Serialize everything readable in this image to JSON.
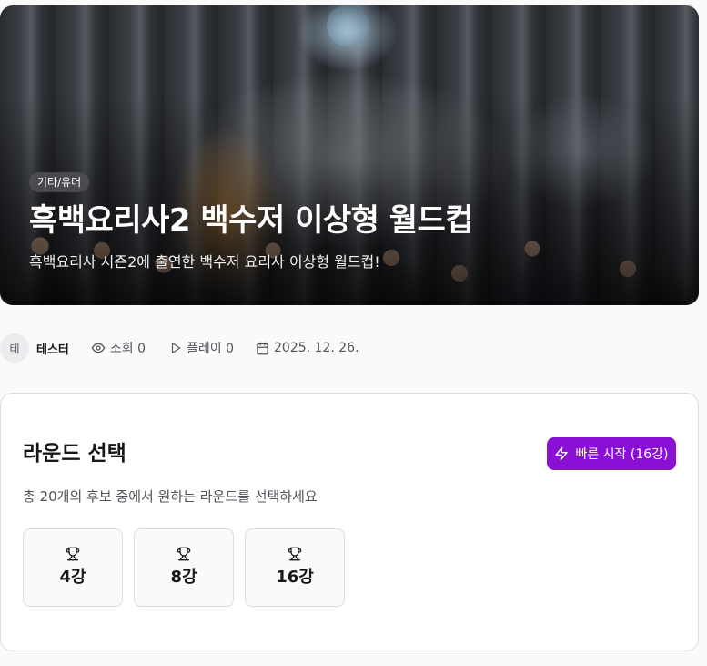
{
  "hero": {
    "badge": "기타/유머",
    "title": "흑백요리사2 백수저 이상형 월드컵",
    "description": "흑백요리사 시즌2에 출연한 백수저 요리사 이상형 월드컵!",
    "image_icon": "cover-image"
  },
  "meta": {
    "avatar_initial": "테",
    "author": "테스터",
    "views_label": "조회 0",
    "views_icon": "eye-icon",
    "plays_label": "플레이 0",
    "plays_icon": "play-icon",
    "date": "2025. 12. 26.",
    "date_icon": "calendar-icon"
  },
  "round_select": {
    "title": "라운드 선택",
    "quick_start_label": "빠른 시작 (16강)",
    "quick_start_icon": "lightning-icon",
    "subtitle": "총 20개의 후보 중에서 원하는 라운드를 선택하세요",
    "round_icon": "trophy-icon",
    "rounds": [
      {
        "label": "4강"
      },
      {
        "label": "8강"
      },
      {
        "label": "16강"
      }
    ]
  },
  "colors": {
    "accent": "#8b10d6",
    "background": "#fafafa",
    "card": "#ffffff",
    "border": "#dcdce0",
    "text": "#18181b",
    "muted_text": "#52525b"
  }
}
